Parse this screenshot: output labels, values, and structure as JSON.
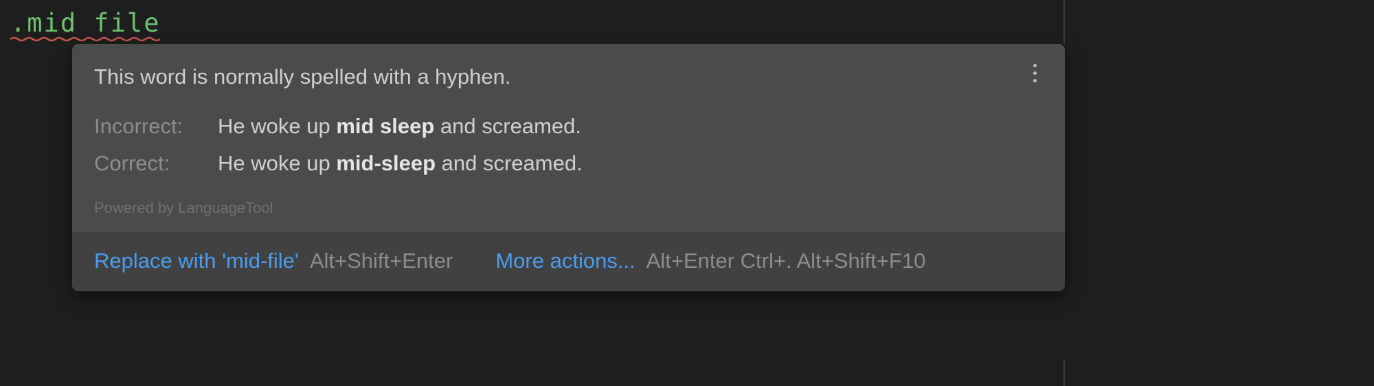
{
  "code": {
    "text": ".mid file"
  },
  "tooltip": {
    "title": "This word is normally spelled with a hyphen.",
    "incorrect_label": "Incorrect:",
    "incorrect_pre": "He woke up ",
    "incorrect_bold": "mid sleep",
    "incorrect_post": " and screamed.",
    "correct_label": "Correct:",
    "correct_pre": "He woke up ",
    "correct_bold": "mid-sleep",
    "correct_post": " and screamed.",
    "powered_by": "Powered by LanguageTool",
    "action_replace": "Replace with 'mid-file'",
    "shortcut_replace": "Alt+Shift+Enter",
    "action_more": "More actions...",
    "shortcut_more": "Alt+Enter Ctrl+. Alt+Shift+F10"
  }
}
